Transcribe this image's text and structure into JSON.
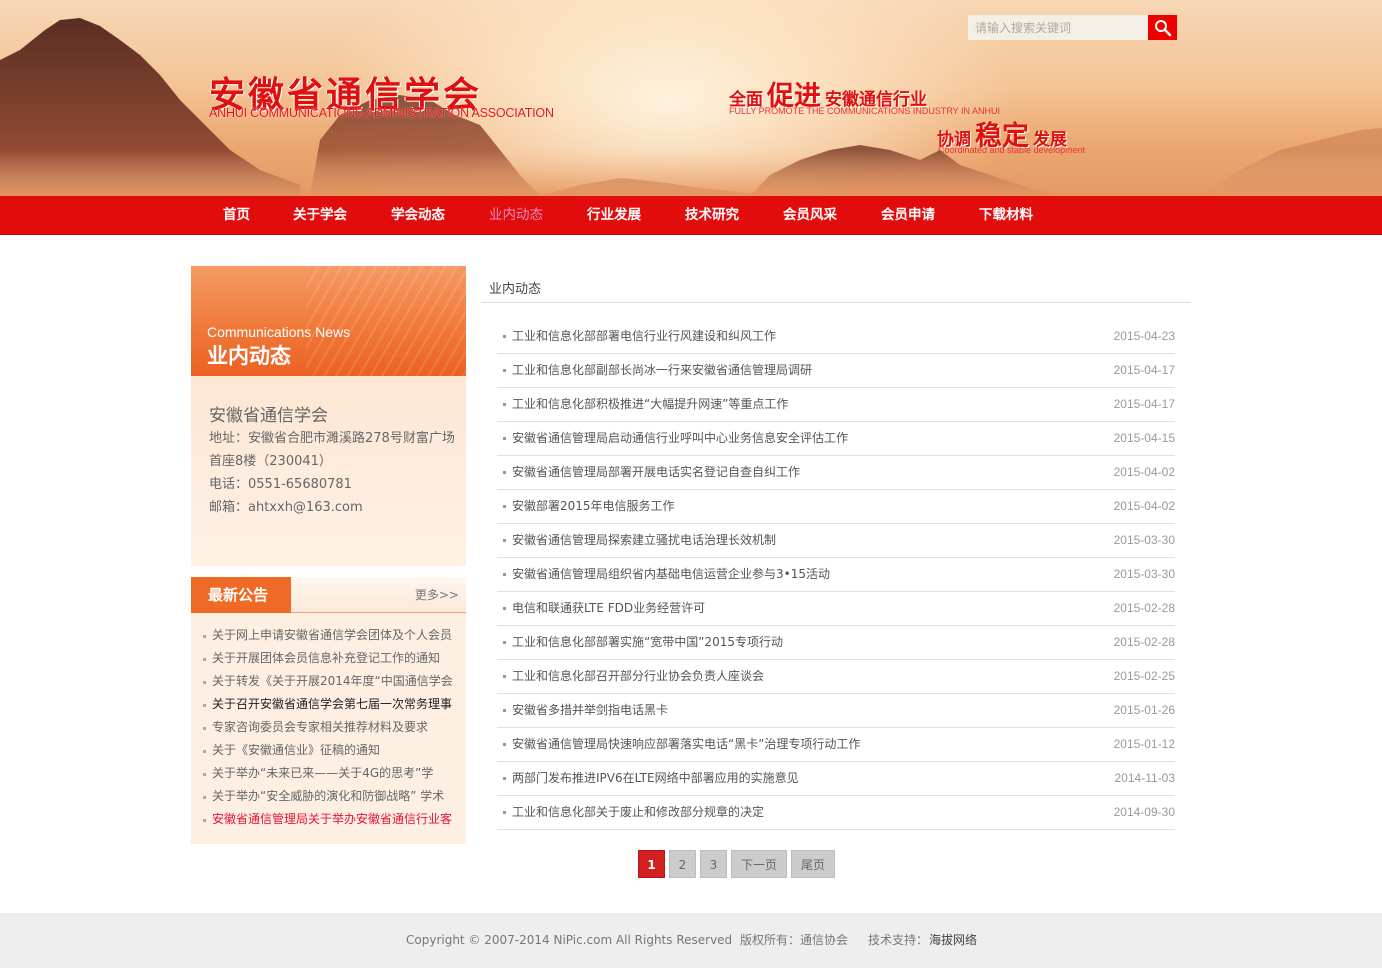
{
  "header": {
    "search_placeholder": "请输入搜索关键词",
    "logo_cn": "安徽省通信学会",
    "logo_en": "ANHUI COMMUNICATIONS ADMINISTRATION ASSOCIATION",
    "slogan1": {
      "a": "全面",
      "b": "促进",
      "c": "安徽通信行业",
      "en": "FULLY PROMOTE THE COMMUNICATIONS INDUSTRY IN ANHUI"
    },
    "slogan2": {
      "a": "协调",
      "b": "稳定",
      "c": "发展",
      "en": "Coordinated and stable development"
    }
  },
  "nav": {
    "items": [
      "首页",
      "关于学会",
      "学会动态",
      "业内动态",
      "行业发展",
      "技术研究",
      "会员风采",
      "会员申请",
      "下载材料"
    ],
    "active_index": 3
  },
  "sidebar": {
    "banner_en": "Communications News",
    "banner_cn": "业内动态",
    "contact": {
      "org": "安徽省通信学会",
      "address1": "地址：安徽省合肥市濉溪路278号财富广场",
      "address2": "首座8楼（230041）",
      "phone": "电话：0551-65680781",
      "email": "邮箱：ahtxxh@163.com"
    },
    "notice": {
      "tab": "最新公告",
      "more": "更多>>",
      "items": [
        "关于网上申请安徽省通信学会团体及个人会员",
        "关于开展团体会员信息补充登记工作的通知",
        "关于转发《关于开展2014年度“中国通信学会",
        "关于召开安徽省通信学会第七届一次常务理事",
        "专家咨询委员会专家相关推荐材料及要求",
        "关于《安徽通信业》征稿的通知",
        "关于举办“未来已来——关于4G的思考”学",
        "关于举办“安全威胁的演化和防御战略” 学术",
        "安徽省通信管理局关于举办安徽省通信行业客"
      ]
    }
  },
  "main": {
    "title": "业内动态",
    "news": [
      {
        "title": "工业和信息化部部署电信行业行风建设和纠风工作",
        "date": "2015-04-23"
      },
      {
        "title": "工业和信息化部副部长尚冰一行来安徽省通信管理局调研",
        "date": "2015-04-17"
      },
      {
        "title": "工业和信息化部积极推进“大幅提升网速”等重点工作",
        "date": "2015-04-17"
      },
      {
        "title": "安徽省通信管理局启动通信行业呼叫中心业务信息安全评估工作",
        "date": "2015-04-15"
      },
      {
        "title": "安徽省通信管理局部署开展电话实名登记自查自纠工作",
        "date": "2015-04-02"
      },
      {
        "title": "安徽部署2015年电信服务工作",
        "date": "2015-04-02"
      },
      {
        "title": "安徽省通信管理局探索建立骚扰电话治理长效机制",
        "date": "2015-03-30"
      },
      {
        "title": "安徽省通信管理局组织省内基础电信运营企业参与3•15活动",
        "date": "2015-03-30"
      },
      {
        "title": "电信和联通获LTE FDD业务经营许可",
        "date": "2015-02-28"
      },
      {
        "title": "工业和信息化部部署实施“宽带中国”2015专项行动",
        "date": "2015-02-28"
      },
      {
        "title": "工业和信息化部召开部分行业协会负责人座谈会",
        "date": "2015-02-25"
      },
      {
        "title": "安徽省多措并举剑指电话黑卡",
        "date": "2015-01-26"
      },
      {
        "title": "安徽省通信管理局快速响应部署落实电话“黑卡”治理专项行动工作",
        "date": "2015-01-12"
      },
      {
        "title": "两部门发布推进IPV6在LTE网络中部署应用的实施意见",
        "date": "2014-11-03"
      },
      {
        "title": "工业和信息化部关于废止和修改部分规章的决定",
        "date": "2014-09-30"
      }
    ],
    "pager": {
      "p1": "1",
      "p2": "2",
      "p3": "3",
      "next": "下一页",
      "last": "尾页"
    }
  },
  "footer": {
    "copyright": "Copyright © 2007-2014 NiPic.com All Rights Reserved",
    "owner_label": "版权所有：",
    "owner": "通信协会",
    "support_label": "技术支持：",
    "support": "海拔网络"
  },
  "colors": {
    "nav_red": "#e30c0c",
    "banner_orange": "#ef6a26",
    "active_nav": "#e48fb8",
    "alert_red": "#e8113a"
  }
}
